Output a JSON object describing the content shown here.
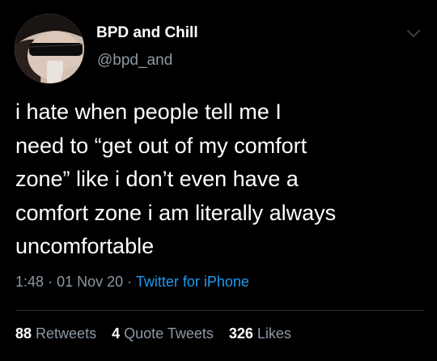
{
  "author": {
    "display_name": "BPD and Chill",
    "handle": "@bpd_and",
    "avatar_icon": "avatar-photo"
  },
  "tweet": {
    "text_lines": [
      "i hate when people tell me I",
      "need to “get out of my comfort",
      "zone” like i don’t even have a",
      "comfort zone i am literally always",
      "uncomfortable"
    ],
    "time": "1:48",
    "date": "01 Nov 20",
    "separator": "·",
    "source": "Twitter for iPhone"
  },
  "stats": {
    "retweets_count": "88",
    "retweets_label": "Retweets",
    "quote_count": "4",
    "quote_label": "Quote Tweets",
    "likes_count": "326",
    "likes_label": "Likes"
  },
  "colors": {
    "background": "#000000",
    "text": "#ffffff",
    "muted": "#8b98a5",
    "link": "#1d9bf0"
  },
  "icons": {
    "caret": "chevron-down-icon"
  }
}
